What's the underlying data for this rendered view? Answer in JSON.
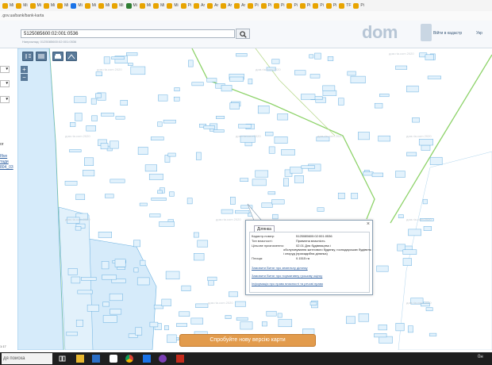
{
  "bookmarks": [
    {
      "label": "Mi",
      "color": "#e8a400"
    },
    {
      "label": "Mi",
      "color": "#e8a400"
    },
    {
      "label": "Mi",
      "color": "#e8a400"
    },
    {
      "label": "Mi",
      "color": "#e8a400"
    },
    {
      "label": "Mi",
      "color": "#e8a400"
    },
    {
      "label": "Mi",
      "color": "#1a73e8"
    },
    {
      "label": "Mi",
      "color": "#e8a400"
    },
    {
      "label": "Mi",
      "color": "#e8a400"
    },
    {
      "label": "Mi",
      "color": "#e8a400"
    },
    {
      "label": "Mi",
      "color": "#2e7d32"
    },
    {
      "label": "Mi",
      "color": "#e8a400"
    },
    {
      "label": "Mi",
      "color": "#e8a400"
    },
    {
      "label": "Mi",
      "color": "#e8a400"
    },
    {
      "label": "Pi",
      "color": "#e8a400"
    },
    {
      "label": "Ar",
      "color": "#e8a400"
    },
    {
      "label": "Ar",
      "color": "#e8a400"
    },
    {
      "label": "Ar",
      "color": "#e8a400"
    },
    {
      "label": "Ar",
      "color": "#e8a400"
    },
    {
      "label": "Pi",
      "color": "#e8a400"
    },
    {
      "label": "Pi",
      "color": "#e8a400"
    },
    {
      "label": "Pi",
      "color": "#e8a400"
    },
    {
      "label": "Pi",
      "color": "#e8a400"
    },
    {
      "label": "Pi",
      "color": "#e8a400"
    },
    {
      "label": "Pi",
      "color": "#e8a400"
    },
    {
      "label": "Pi",
      "color": "#e8a400"
    },
    {
      "label": "TF",
      "color": "#e8a400"
    },
    {
      "label": "Pi",
      "color": "#e8a400"
    }
  ],
  "url": ".gov.ua/bank/bank-karta",
  "search": {
    "value": "5125085600:02:001:0536",
    "hint": "Наприклад: 0125085600:02:001:0536"
  },
  "header": {
    "logo": "dom",
    "login": "Війти в кадастр",
    "lang": "Укр"
  },
  "map": {
    "watermark": "дом.ria.com 2020"
  },
  "left_panel": {
    "text_1": "ог",
    "link_1": "Ifive",
    "link_2": "тади",
    "link_3": "804_03",
    "scale": "1:17"
  },
  "popup": {
    "tab": "Ділянка",
    "rows": [
      {
        "label": "Кадастр.номер:",
        "value": "5125085600:02:001:0536"
      },
      {
        "label": "Тип власності:",
        "value": "Приватна власність"
      },
      {
        "label": "Цільове призначення:",
        "value": "02.01 Для будівництва і"
      },
      {
        "label": "",
        "value": "обслуговування житлового будинку, господарських будівель"
      },
      {
        "label": "",
        "value": "і споруд (присадибна ділянка)"
      },
      {
        "label": "Площа:",
        "value": "0.1515 га"
      }
    ],
    "links": [
      "Замовити Витяг про земельну ділянку",
      "Замовити Витяг про нормативну грошову оцінку",
      "Інформація про право власності та речові права"
    ]
  },
  "try_button": "Спробуйте нову версію карти",
  "taskbar": {
    "search_placeholder": "дя поиска",
    "notice": "0н"
  }
}
